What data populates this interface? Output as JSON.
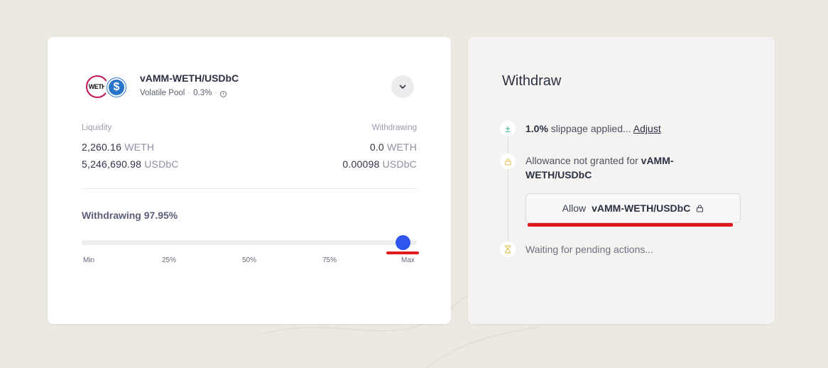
{
  "pool": {
    "name": "vAMM-WETH/USDbC",
    "type": "Volatile Pool",
    "fee": "0.3%",
    "token0_symbol": "WETH",
    "token1_symbol": "$"
  },
  "liquidity": {
    "label": "Liquidity",
    "rows": [
      {
        "amount": "2,260.16",
        "unit": "WETH"
      },
      {
        "amount": "5,246,690.98",
        "unit": "USDbC"
      }
    ]
  },
  "withdrawing": {
    "label": "Withdrawing",
    "rows": [
      {
        "amount": "0.0",
        "unit": "WETH"
      },
      {
        "amount": "0.00098",
        "unit": "USDbC"
      }
    ]
  },
  "slider": {
    "title": "Withdrawing 97.95%",
    "value_percent": 97.95,
    "ticks": [
      "Min",
      "25%",
      "50%",
      "75%",
      "Max"
    ],
    "accent": "#2f55f0"
  },
  "withdraw_panel": {
    "title": "Withdraw",
    "slippage": {
      "value": "1.0%",
      "text": " slippage applied... ",
      "link": "Adjust"
    },
    "allowance": {
      "text": "Allowance not granted for ",
      "pool": "vAMM-WETH/USDbC"
    },
    "allow_button": {
      "label": "Allow",
      "pool": "vAMM-WETH/USDbC"
    },
    "waiting": "Waiting for pending actions..."
  },
  "annotation_color": "#e0191f"
}
